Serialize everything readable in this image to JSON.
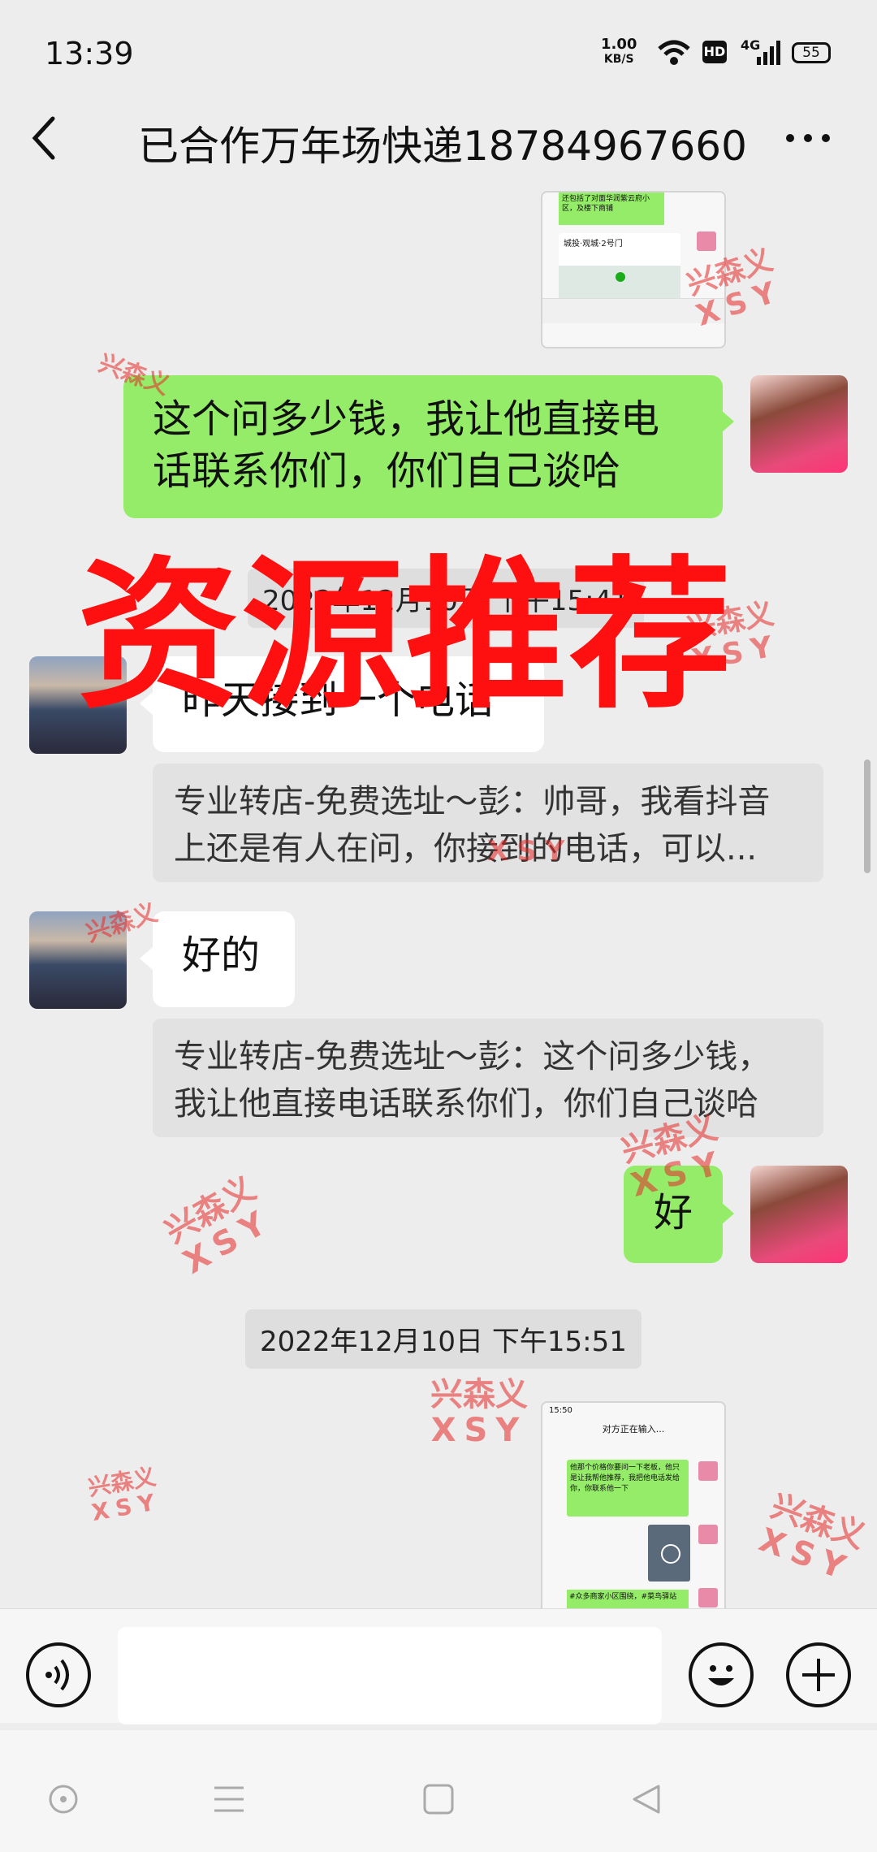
{
  "status_bar": {
    "time": "13:39",
    "net_speed_value": "1.00",
    "net_speed_unit": "KB/S",
    "hd": "HD",
    "signal_type": "4G",
    "battery": "55"
  },
  "header": {
    "title": "已合作万年场快递18784967660"
  },
  "messages": {
    "m1_text": "这个问多少钱，我让他直接电话联系你们，你们自己谈哈",
    "ts1": "2022年12月10日 下午15:41",
    "m2_text": "昨天接到一个电话",
    "q2_text": "专业转店-免费选址～彭：帅哥，我看抖音上还是有人在问，你接到的电话，可以...",
    "m3_text": "好的",
    "q3_text": "专业转店-免费选址～彭：这个问多少钱，我让他直接电话联系你们，你们自己谈哈",
    "m4_text": "好",
    "ts2": "2022年12月10日 下午15:51"
  },
  "thumb1": {
    "card_title": "城投·观城·2号门",
    "text_line": "还包括了对面华润紫云府小区，及楼下商铺"
  },
  "thumb2": {
    "time": "15:50",
    "title": "对方正在输入...",
    "msg": "他那个价格你要问一下老板，他只是让我帮他推荐，我把他电话发给你，你联系他一下",
    "tag": "#众多商家小区围绕，#菜鸟驿站"
  },
  "overlay": {
    "big_title": "资源推荐",
    "watermark_cn": "兴森义",
    "watermark_en": "XSY"
  },
  "icons": {
    "back": "chevron-left-icon",
    "more": "more-dots-icon",
    "voice": "voice-icon",
    "emoji": "emoji-icon",
    "plus": "plus-icon"
  },
  "colors": {
    "sent_bubble": "#95ec69",
    "received_bubble": "#ffffff",
    "background": "#ededed",
    "overlay_red": "#ff1010"
  }
}
